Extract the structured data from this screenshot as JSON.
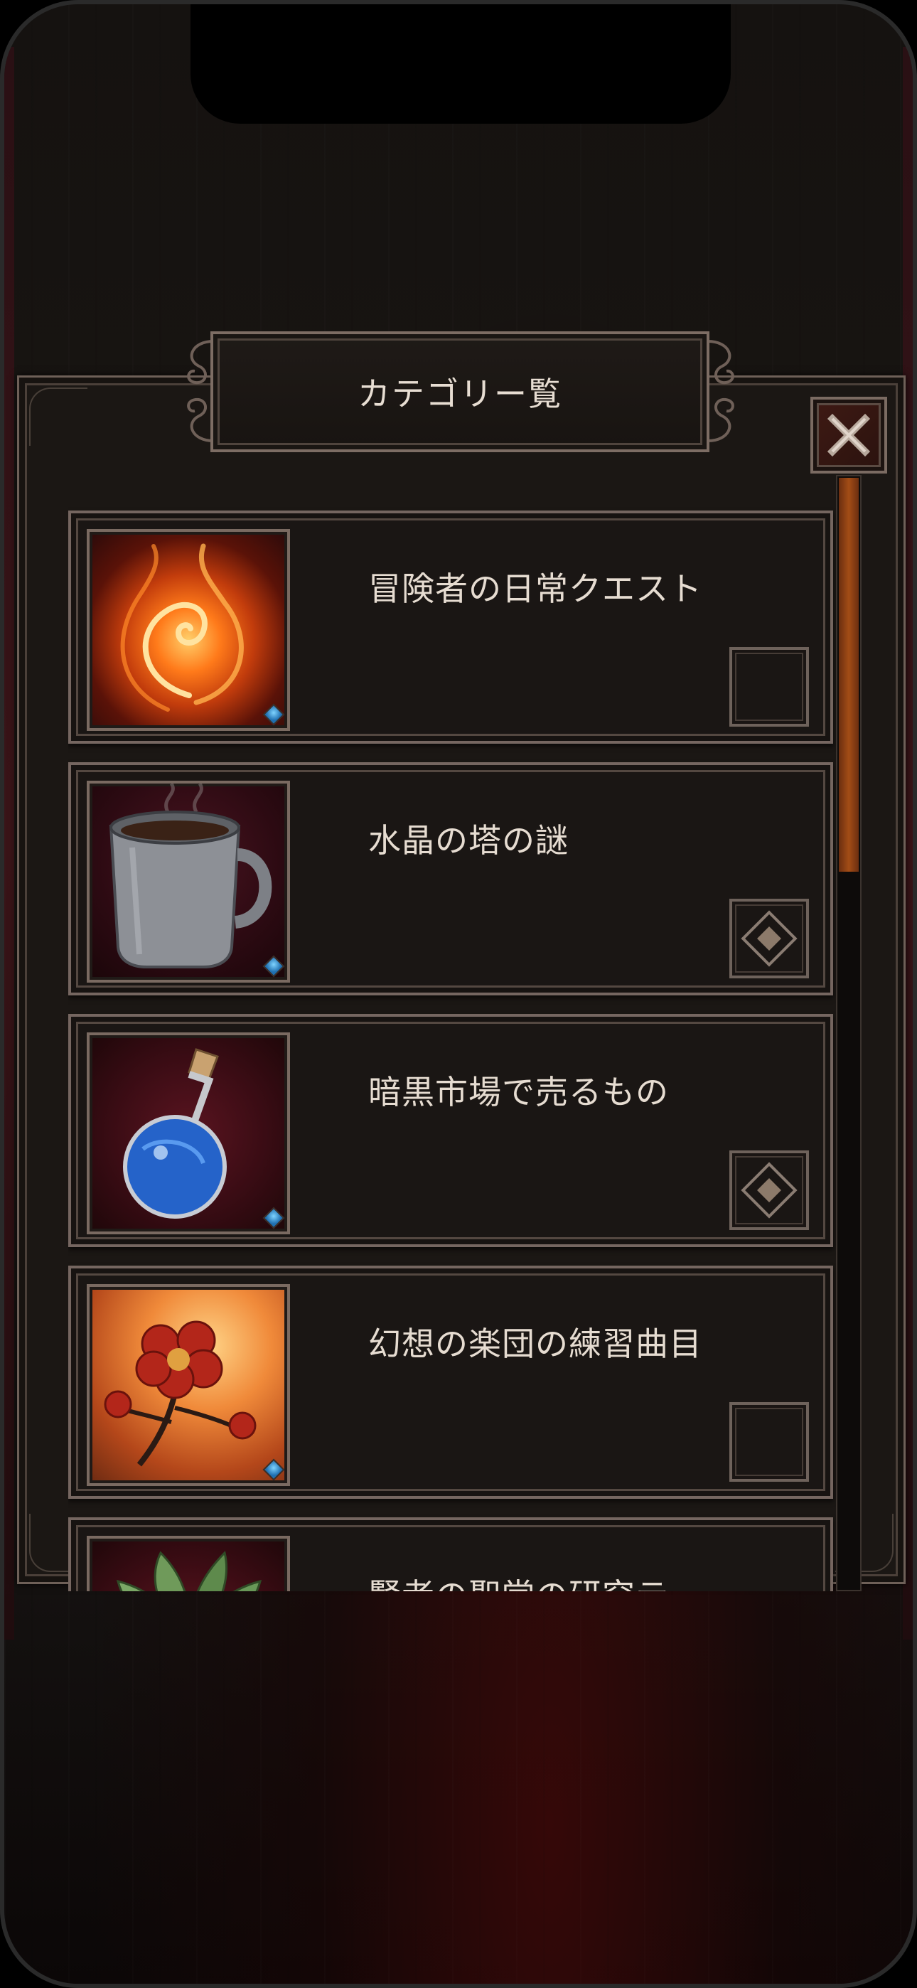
{
  "dialog": {
    "title": "カテゴリー覧",
    "close_label": "X"
  },
  "categories": [
    {
      "label": "冒険者の日常クエスト",
      "icon": "fire-swirl-icon",
      "state": "unchecked"
    },
    {
      "label": "水晶の塔の謎",
      "icon": "coffee-mug-icon",
      "state": "diamond-marked"
    },
    {
      "label": "暗黒市場で売るもの",
      "icon": "blue-potion-icon",
      "state": "diamond-marked"
    },
    {
      "label": "幻想の楽団の練習曲目",
      "icon": "red-flower-icon",
      "state": "unchecked"
    },
    {
      "label": "賢者の聖堂の研究テー",
      "icon": "green-leaves-icon",
      "state": "unchecked"
    }
  ],
  "colors": {
    "scroll_thumb": "#a34d16",
    "panel_bg": "#1b1714",
    "text": "#e6dcd1"
  }
}
